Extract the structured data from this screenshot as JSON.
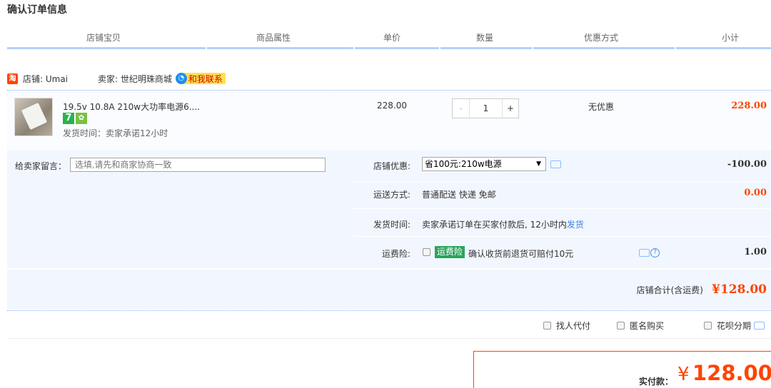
{
  "page_title": "确认订单信息",
  "headers": [
    "店铺宝贝",
    "商品属性",
    "单价",
    "数量",
    "优惠方式",
    "小计"
  ],
  "shop": {
    "badge": "淘",
    "name": "店铺: Umai",
    "seller": "卖家: 世纪明珠商城",
    "contact_label": "和我联系"
  },
  "item": {
    "title": "19.5v 10.8A 210w大功率电源6....",
    "tag_seven": "7",
    "ship_note": "发货时间：卖家承诺12小时",
    "unit_price": "228.00",
    "qty_minus": "-",
    "qty_value": "1",
    "qty_plus": "+",
    "discount": "无优惠",
    "subtotal": "228.00"
  },
  "message": {
    "label": "给卖家留言：",
    "placeholder": "选填,请先和商家协商一致"
  },
  "shop_discount": {
    "label": "店铺优惠:",
    "selected": "省100元:210w电源",
    "amount": "-100.00"
  },
  "shipping": {
    "label": "运送方式:",
    "value": "普通配送 快递 免邮",
    "amount": "0.00"
  },
  "delivery": {
    "label": "发货时间:",
    "text": "卖家承诺订单在买家付款后, 12小时内",
    "link": "发货"
  },
  "insurance": {
    "label": "运费险:",
    "badge": "运费险",
    "text": "确认收货前退货可赔付10元",
    "help": "?",
    "amount": "1.00"
  },
  "shop_total": {
    "label": "店铺合计(含运费)",
    "amount": "¥128.00"
  },
  "options": [
    "找人代付",
    "匿名购买",
    "花呗分期"
  ],
  "payment": {
    "label": "实付款：",
    "currency": "¥",
    "amount": "128.00"
  },
  "colors": {
    "accent": "#ff4400",
    "link": "#3c7ee3",
    "header_line": "#b2d1ff",
    "panel_bg": "#f2f7ff",
    "insurance_green": "#2aa55a"
  }
}
